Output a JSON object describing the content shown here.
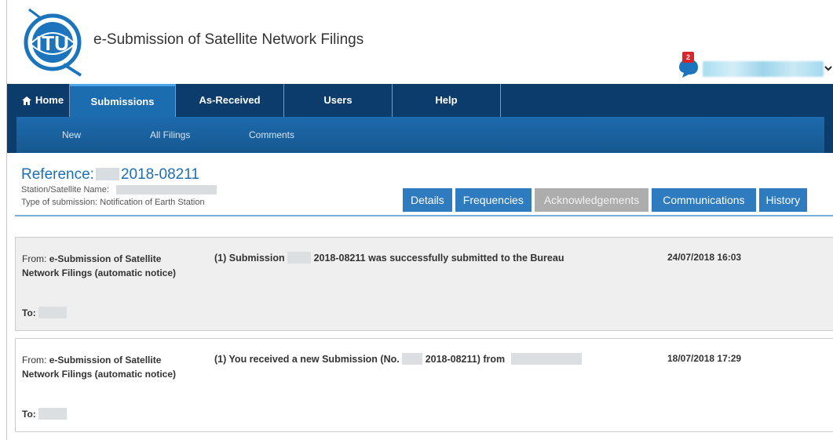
{
  "app": {
    "title": "e-Submission of Satellite Network Filings",
    "notifications_count": "2"
  },
  "nav": {
    "items": [
      {
        "label": "Home",
        "icon": "home-icon"
      },
      {
        "label": "Submissions",
        "active": true
      },
      {
        "label": "As-Received"
      },
      {
        "label": "Users"
      },
      {
        "label": "Help"
      }
    ]
  },
  "subnav": {
    "items": [
      {
        "label": "New"
      },
      {
        "label": "All Filings"
      },
      {
        "label": "Comments"
      }
    ]
  },
  "reference": {
    "label": "Reference:",
    "number": "2018-08211",
    "station_label": "Station/Satellite Name:",
    "type_label": "Type of submission: Notification of Earth Station"
  },
  "tabs": [
    {
      "label": "Details"
    },
    {
      "label": "Frequencies"
    },
    {
      "label": "Acknowledgements",
      "active": true
    },
    {
      "label": "Communications"
    },
    {
      "label": "History"
    }
  ],
  "messages": [
    {
      "from_label": "From:",
      "from_value": "e-Submission of Satellite Network Filings (automatic notice)",
      "to_label": "To:",
      "body_prefix": "(1) Submission",
      "body_number": "2018-08211",
      "body_suffix": "was successfully submitted to the Bureau",
      "date": "24/07/2018 16:03"
    },
    {
      "from_label": "From:",
      "from_value": "e-Submission of Satellite Network Filings (automatic notice)",
      "to_label": "To:",
      "body_prefix": "(1) You received a new Submission (No.",
      "body_number": "2018-08211) from",
      "body_suffix": "",
      "date": "18/07/2018 17:29"
    }
  ],
  "colors": {
    "nav_bg": "#0b3c6b",
    "active_tab": "#1c6cb0",
    "accent_blue": "#2e7bbf",
    "badge_red": "#d9252a"
  }
}
